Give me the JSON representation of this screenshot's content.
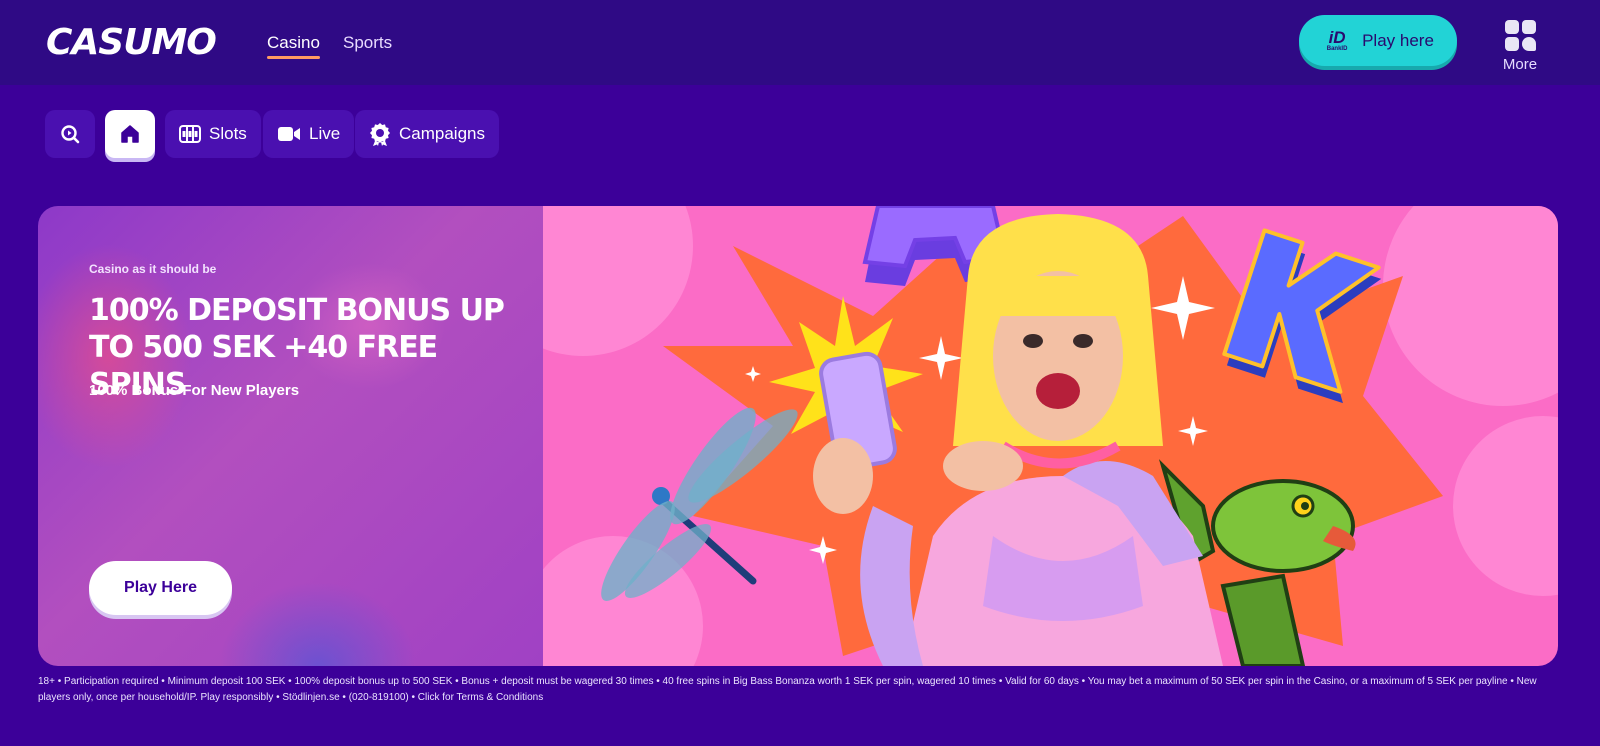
{
  "header": {
    "logo": "CASUMO",
    "nav": [
      {
        "label": "Casino",
        "active": true
      },
      {
        "label": "Sports",
        "active": false
      }
    ],
    "play_button": {
      "label": "Play here",
      "bankid_mark": "iD",
      "bankid_text": "BankID"
    },
    "more_label": "More"
  },
  "categories": [
    {
      "label": "",
      "icon": "search-icon"
    },
    {
      "label": "",
      "icon": "home-icon"
    },
    {
      "label": "Slots",
      "icon": "slots-icon"
    },
    {
      "label": "Live",
      "icon": "video-camera-icon"
    },
    {
      "label": "Campaigns",
      "icon": "award-badge-icon"
    }
  ],
  "banner": {
    "tagline": "Casino as it should be",
    "headline": "100% DEPOSIT BONUS UP TO 500 SEK +40 FREE SPINS",
    "subheadline": "100% Bonus For New Players",
    "button_label": "Play Here"
  },
  "disclaimer": "18+ • Participation required • Minimum deposit 100 SEK • 100% deposit bonus up to 500 SEK • Bonus + deposit must be wagered 30 times • 40 free spins in Big Bass Bonanza worth 1 SEK per spin, wagered 10 times • Valid for 60 days • You may bet a maximum of 50 SEK per spin in the Casino, or a maximum of 5 SEK per payline • New players only, once per household/IP. Play responsibly • Stödlinjen.se • (020-819100) • Click for Terms & Conditions",
  "colors": {
    "background": "#3c0099",
    "header": "#2f0a85",
    "accent_teal": "#22d3d6",
    "underline_orange": "#ff9b62",
    "banner_pink": "#fb6cc6",
    "banner_orange": "#ff6a3d"
  }
}
